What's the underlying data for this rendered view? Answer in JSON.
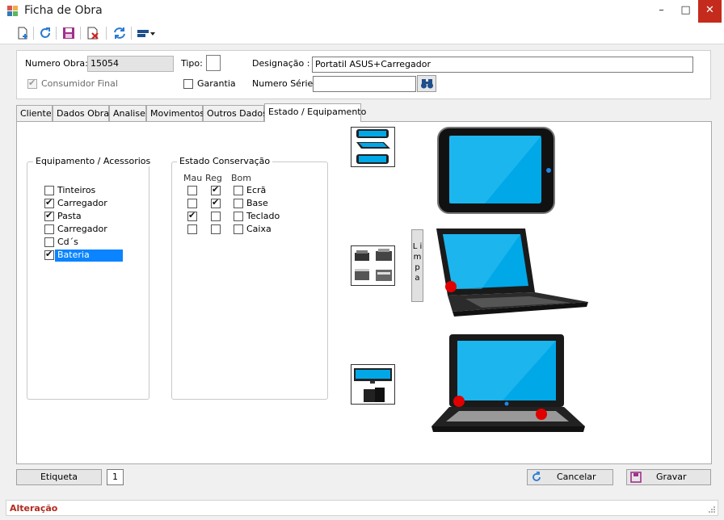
{
  "window": {
    "title": "Ficha de Obra",
    "minimize": "–",
    "maximize": "□",
    "close": "✕"
  },
  "toolbar": {
    "items": [
      "new-icon",
      "refresh-icon",
      "save-icon",
      "delete-icon",
      "sync-icon",
      "layout-dropdown-icon"
    ]
  },
  "header": {
    "numero_obra_label": "Numero Obra:",
    "numero_obra_value": "15054",
    "tipo_label": "Tipo:",
    "tipo_value": "",
    "designacao_label": "Designação :",
    "designacao_value": "Portatil ASUS+Carregador",
    "consumidor_final_label": "Consumidor Final",
    "consumidor_final_checked": true,
    "garantia_label": "Garantia",
    "garantia_checked": false,
    "numero_serie_label": "Numero Série:",
    "numero_serie_value": ""
  },
  "tabs": [
    {
      "label": "Cliente"
    },
    {
      "label": "Dados Obra"
    },
    {
      "label": "Analise"
    },
    {
      "label": "Movimentos"
    },
    {
      "label": "Outros Dados"
    },
    {
      "label": "Estado / Equipamento",
      "active": true
    }
  ],
  "equipamento": {
    "title": "Equipamento / Acessorios",
    "items": [
      {
        "label": "Tinteiros",
        "checked": false
      },
      {
        "label": "Carregador",
        "checked": true
      },
      {
        "label": "Pasta",
        "checked": true
      },
      {
        "label": "Carregador",
        "checked": false
      },
      {
        "label": "Cd´s",
        "checked": false
      },
      {
        "label": "Bateria",
        "checked": true,
        "selected": true
      }
    ]
  },
  "conservacao": {
    "title": "Estado Conservação",
    "columns": [
      "Mau",
      "Reg",
      "Bom"
    ],
    "rows": [
      {
        "label": "Ecrã",
        "mau": false,
        "reg": true,
        "bom": false
      },
      {
        "label": "Base",
        "mau": false,
        "reg": true,
        "bom": false
      },
      {
        "label": "Teclado",
        "mau": true,
        "reg": false,
        "bom": false
      },
      {
        "label": "Caixa",
        "mau": false,
        "reg": false,
        "bom": false
      }
    ]
  },
  "limpa_label": "L i m p a",
  "colors": {
    "screen": "#00a8e8",
    "damage_marker": "#e00000",
    "status_text": "#b22a1e"
  },
  "footer": {
    "etiqueta_label": "Etiqueta",
    "copies": "1",
    "cancelar_label": "Cancelar",
    "gravar_label": "Gravar",
    "status": "Alteração"
  }
}
